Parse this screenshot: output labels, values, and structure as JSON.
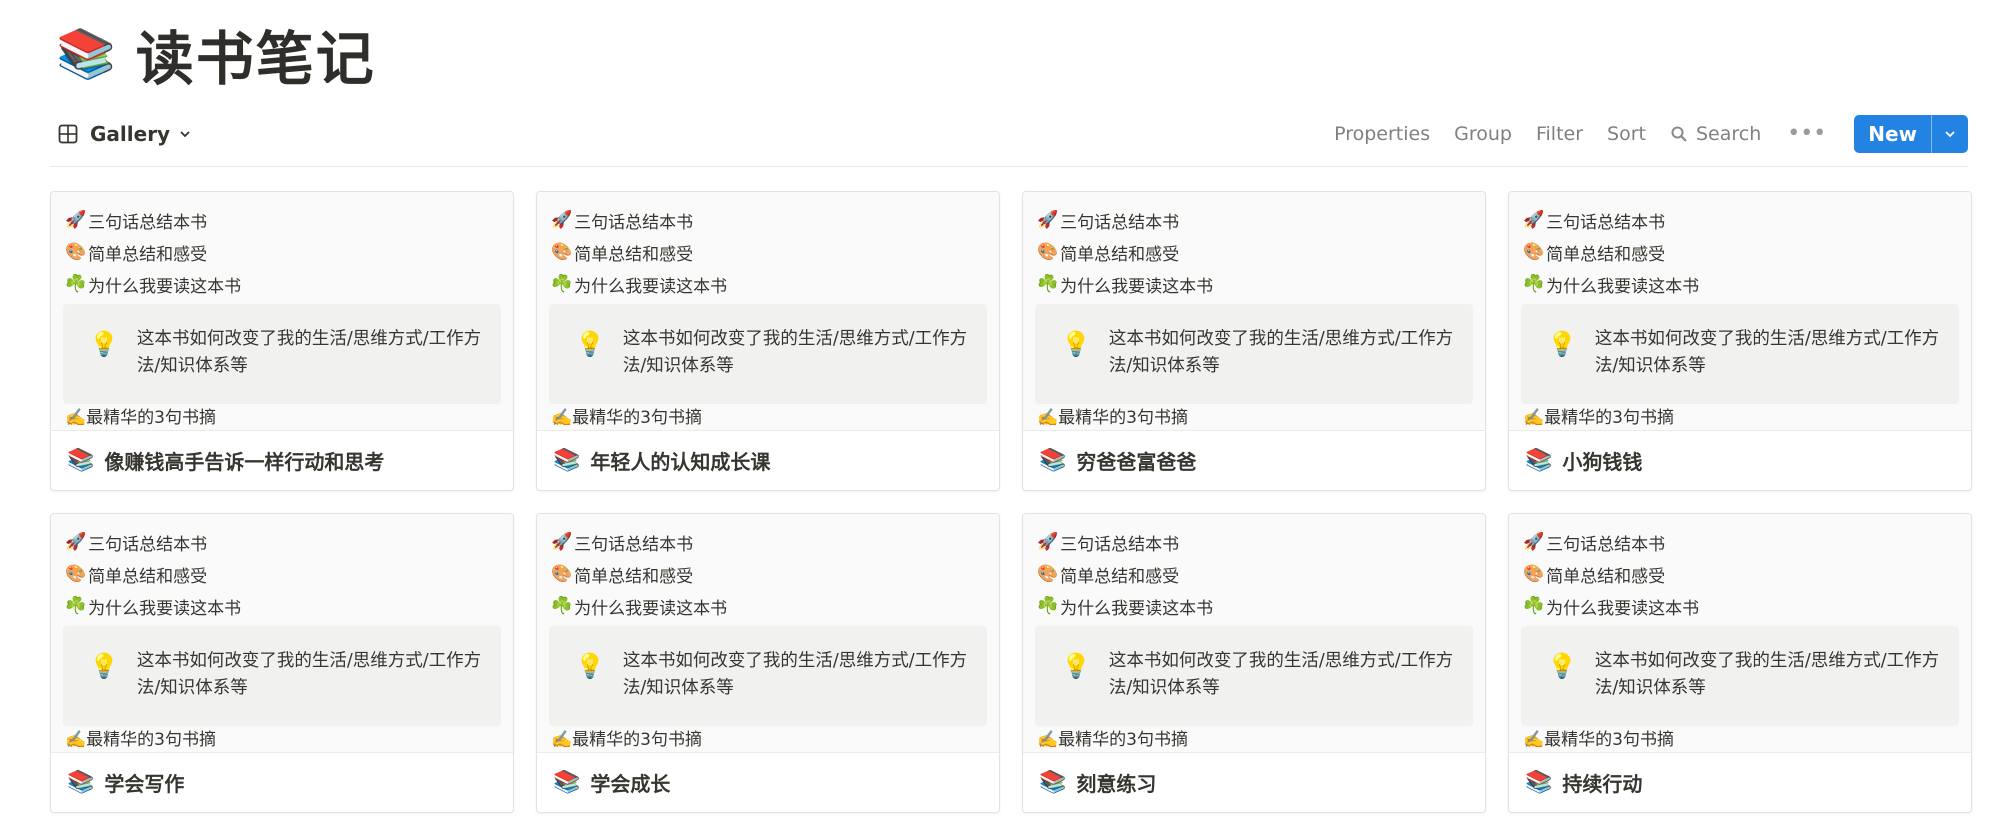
{
  "page": {
    "icon": "📚",
    "title": "读书笔记"
  },
  "toolbar": {
    "view_label": "Gallery",
    "view_icon": "gallery-grid-icon",
    "properties": "Properties",
    "group": "Group",
    "filter": "Filter",
    "sort": "Sort",
    "search": "Search",
    "more": "•••",
    "new": "New",
    "accent_color": "#2383e2"
  },
  "preview_template": {
    "line1_emoji": "🚀",
    "line1": "三句话总结本书",
    "line2_emoji": "🎨",
    "line2": "简单总结和感受",
    "line3_emoji": "☘️",
    "line3": "为什么我要读这本书",
    "callout_icon": "💡",
    "callout": "这本书如何改变了我的生活/思维方式/工作方法/知识体系等",
    "bottom_emoji": "✍️",
    "bottom": "最精华的3句书摘"
  },
  "cards": [
    {
      "icon": "📚",
      "title": "像赚钱高手告诉一样行动和思考"
    },
    {
      "icon": "📚",
      "title": "年轻人的认知成长课"
    },
    {
      "icon": "📚",
      "title": "穷爸爸富爸爸"
    },
    {
      "icon": "📚",
      "title": "小狗钱钱"
    },
    {
      "icon": "📚",
      "title": "学会写作"
    },
    {
      "icon": "📚",
      "title": "学会成长"
    },
    {
      "icon": "📚",
      "title": "刻意练习"
    },
    {
      "icon": "📚",
      "title": "持续行动"
    }
  ]
}
